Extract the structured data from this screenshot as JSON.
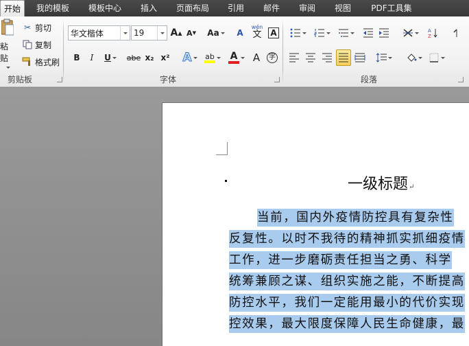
{
  "tabs": [
    {
      "label": "开始",
      "active": true
    },
    {
      "label": "我的模板"
    },
    {
      "label": "模板中心"
    },
    {
      "label": "插入"
    },
    {
      "label": "页面布局"
    },
    {
      "label": "引用"
    },
    {
      "label": "邮件"
    },
    {
      "label": "审阅"
    },
    {
      "label": "视图"
    },
    {
      "label": "PDF工具集"
    }
  ],
  "clipboard": {
    "paste_label": "粘贴",
    "cut_label": "剪切",
    "copy_label": "复制",
    "format_painter_label": "格式刷",
    "group_label": "剪贴板"
  },
  "font": {
    "font_name": "华文楷体",
    "font_size": "19",
    "grow_label": "A",
    "shrink_label": "A",
    "case_label": "Aa",
    "clear_format_label": "A",
    "phonetic_label": "wén",
    "border_char_label": "A",
    "bold_label": "B",
    "italic_label": "I",
    "underline_label": "U",
    "strike_label": "abe",
    "subscript_label": "x₂",
    "superscript_label": "x²",
    "text_effect_label": "A",
    "highlight_label": "ab",
    "font_color_label": "A",
    "char_shading_label": "A",
    "enclose_char_label": "字",
    "group_label": "字体",
    "highlight_color": "#ffff00",
    "font_color": "#e02020"
  },
  "paragraph": {
    "group_label": "段落"
  },
  "document": {
    "heading": "一级标题",
    "paragraph_mark": "↵",
    "lines": [
      "当前，国内外疫情防控具有复杂性",
      "反复性。以时不我待的精神抓实抓细疫情",
      "工作，进一步磨砺责任担当之勇、科学",
      "统筹兼顾之谋、组织实施之能，不断提高",
      "防控水平，我们一定能用最小的代价实现",
      "控效果，最大限度保障人民生命健康，最"
    ],
    "selection_color": "#a8cbee"
  }
}
